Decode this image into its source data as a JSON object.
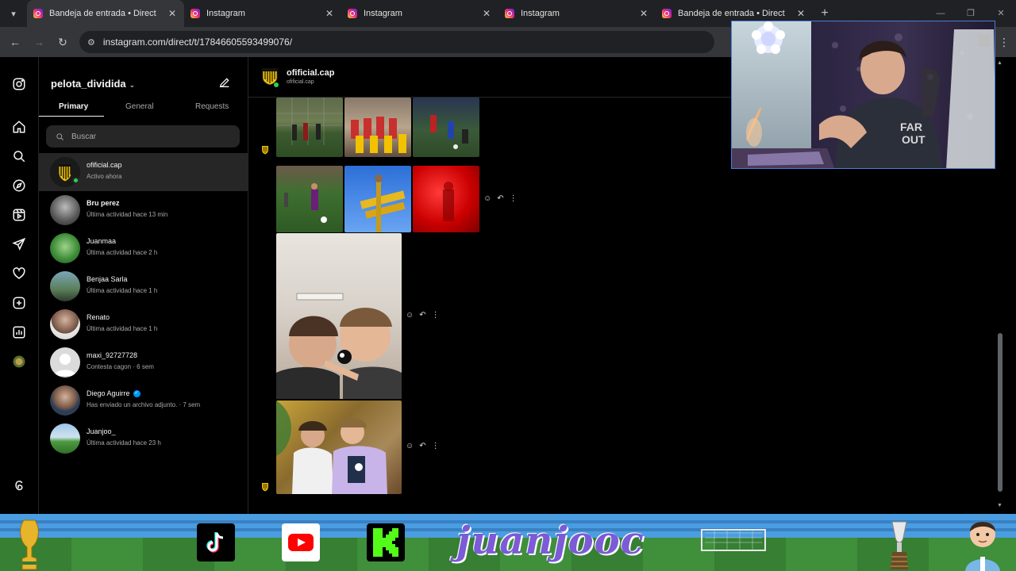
{
  "browser": {
    "tabs": [
      {
        "title": "Bandeja de entrada • Direct",
        "active": true
      },
      {
        "title": "Instagram",
        "active": false
      },
      {
        "title": "Instagram",
        "active": false
      },
      {
        "title": "Instagram",
        "active": false
      },
      {
        "title": "Bandeja de entrada • Direct",
        "active": false
      }
    ],
    "url": "instagram.com/direct/t/17846605593499076/"
  },
  "rail": {
    "icons": [
      "instagram-logo-icon",
      "home-icon",
      "search-icon",
      "explore-icon",
      "reels-icon",
      "messages-icon",
      "notifications-icon",
      "create-icon",
      "dashboard-icon",
      "profile-icon",
      "threads-icon"
    ]
  },
  "inbox": {
    "username": "pelota_dividida",
    "tabs": {
      "primary": "Primary",
      "general": "General",
      "requests": "Requests"
    },
    "search_placeholder": "Buscar",
    "conversations": [
      {
        "name": "ofificial.cap",
        "sub": "Activo ahora",
        "selected": true,
        "online": true
      },
      {
        "name": "Bru perez",
        "sub": "Última actividad hace 13 min"
      },
      {
        "name": "Juanmaa",
        "sub": "Última actividad hace 2 h"
      },
      {
        "name": "Benjaa Sarla",
        "sub": "Última actividad hace 1 h"
      },
      {
        "name": "Renato",
        "sub": "Última actividad hace 1 h"
      },
      {
        "name": "maxi_92727728",
        "sub": "Contesta cagon · 6 sem"
      },
      {
        "name": "Diego Aguirre",
        "sub": "Has enviado un archivo adjunto. · 7 sem",
        "verified": true
      },
      {
        "name": "Juanjoo_",
        "sub": "Última actividad hace 23 h"
      }
    ]
  },
  "chat": {
    "name": "ofificial.cap",
    "handle": "ofificial.cap"
  },
  "banner": {
    "channel_name": "juanjooc"
  },
  "colors": {
    "accent_blue": "#0095f6",
    "online_green": "#2bd15a",
    "banner_text": "#7b5bd6"
  }
}
